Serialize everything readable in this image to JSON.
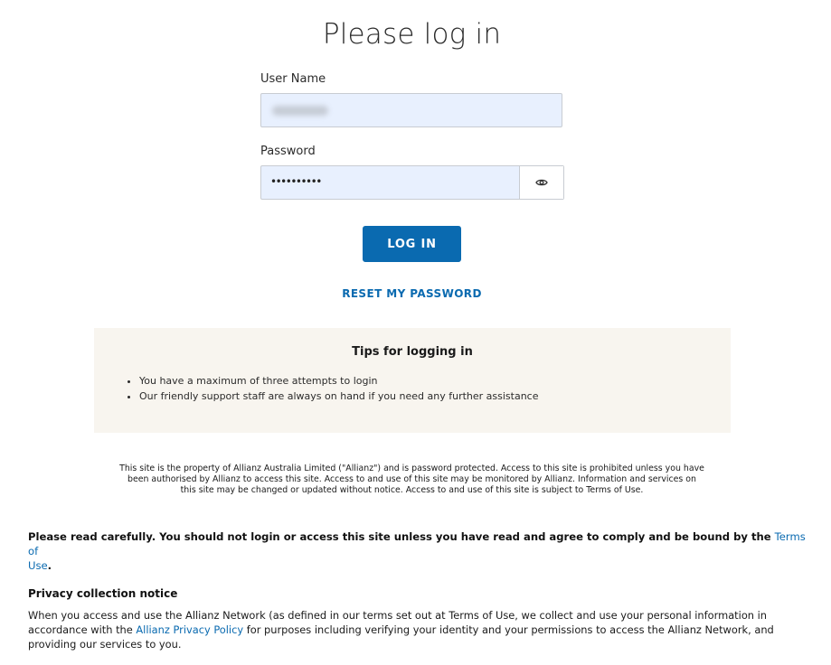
{
  "page": {
    "title": "Please log in"
  },
  "form": {
    "username_label": "User Name",
    "password_label": "Password",
    "password_value": "••••••••••",
    "login_label": "LOG IN",
    "reset_label": "RESET MY PASSWORD"
  },
  "tips": {
    "title": "Tips for logging in",
    "items": [
      "You have a maximum of three attempts to login",
      "Our friendly support staff are always on hand if you need any further assistance"
    ]
  },
  "disclaimer": {
    "line1": "This site is the property of Allianz Australia Limited (\"Allianz\") and is password protected. Access to this site is prohibited unless you have",
    "line2": "been authorised by Allianz to access this site. Access to and use of this site may be monitored by Allianz. Information and services on",
    "line3": "this site may be changed or updated without notice. Access to and use of this site is subject to Terms of Use."
  },
  "notice": {
    "text": "Please read carefully. You should not login or access this site unless you have read and agree to comply and be bound by the ",
    "link_part1": "Terms of",
    "link_part2": "Use",
    "end": "."
  },
  "privacy": {
    "title": "Privacy collection notice",
    "text_before": "When you access and use the Allianz Network (as defined in our terms set out at Terms of Use, we collect and use your personal information in accordance with the ",
    "link": "Allianz Privacy Policy",
    "text_after": " for purposes including verifying your identity and your permissions to access the Allianz Network, and providing our services to you."
  },
  "icons": {
    "eye": "eye-icon"
  },
  "colors": {
    "accent": "#0a6ab0",
    "field_bg": "#e8f0fe",
    "tips_bg": "#f8f5ef"
  }
}
